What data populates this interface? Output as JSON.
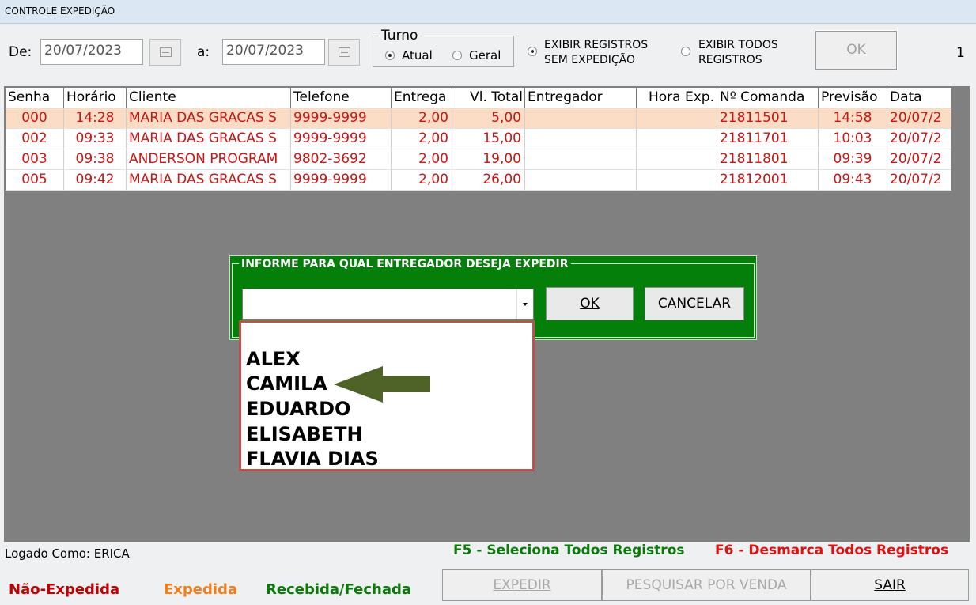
{
  "window": {
    "title": "CONTROLE EXPEDIÇÃO"
  },
  "filters": {
    "from_label": "De:",
    "from_date": "20/07/2023",
    "to_label": "a:",
    "to_date": "20/07/2023",
    "turno": {
      "title": "Turno",
      "option_atual": "Atual",
      "option_geral": "Geral",
      "selected": "Atual"
    },
    "exibir_sem": "EXIBIR REGISTROS SEM EXPEDIÇÃO",
    "exibir_sem_line1": "EXIBIR REGISTROS",
    "exibir_sem_line2": "SEM EXPEDIÇÃO",
    "exibir_todos_line1": "EXIBIR TODOS",
    "exibir_todos_line2": "REGISTROS",
    "ok_label": "OK",
    "count": "1"
  },
  "table": {
    "headers": [
      "Senha",
      "Horário",
      "Cliente",
      "Telefone",
      "Entrega",
      "Vl. Total",
      "Entregador",
      "Hora Exp.",
      "Nº Comanda",
      "Previsão",
      "Data"
    ],
    "rows": [
      [
        "000",
        "14:28",
        "MARIA DAS GRACAS S",
        "9999-9999",
        "2,00",
        "5,00",
        "",
        "",
        "21811501",
        "14:58",
        "20/07/2"
      ],
      [
        "002",
        "09:33",
        "MARIA DAS GRACAS S",
        "9999-9999",
        "2,00",
        "15,00",
        "",
        "",
        "21811701",
        "10:03",
        "20/07/2"
      ],
      [
        "003",
        "09:38",
        "ANDERSON PROGRAM",
        "9802-3692",
        "2,00",
        "19,00",
        "",
        "",
        "21811801",
        "09:39",
        "20/07/2"
      ],
      [
        "005",
        "09:42",
        "MARIA DAS GRACAS S",
        "9999-9999",
        "2,00",
        "26,00",
        "",
        "",
        "21812001",
        "09:43",
        "20/07/2"
      ]
    ]
  },
  "dialog": {
    "title": "INFORME PARA QUAL ENTREGADOR DESEJA EXPEDIR",
    "combo_value": "",
    "ok_label": "OK",
    "cancel_label": "CANCELAR",
    "options": [
      "ALEX",
      "CAMILA",
      "EDUARDO",
      "ELISABETH",
      "FLAVIA DIAS"
    ]
  },
  "footer": {
    "logged_as": "Logado Como: ERICA",
    "f5_hint": "F5 - Seleciona Todos Registros",
    "f6_hint": "F6 - Desmarca Todos Registros",
    "legend_nao": "Não-Expedida",
    "legend_expedida": "Expedida",
    "legend_recebida": "Recebida/Fechada",
    "btn_expedir": "EXPEDIR",
    "btn_pesquisar": "PESQUISAR POR VENDA",
    "btn_sair": "SAIR"
  },
  "colors": {
    "dialog_green": "#047f0a",
    "row_text_red": "#c81414",
    "selected_row": "#fbdcc4",
    "legend_red": "#c00000",
    "legend_orange": "#f07f1a",
    "legend_green": "#0b7a0b",
    "arrow_olive": "#4f6228"
  },
  "icons": [
    "calendar-icon",
    "dropdown-arrow-icon",
    "pointer-arrow-icon"
  ]
}
